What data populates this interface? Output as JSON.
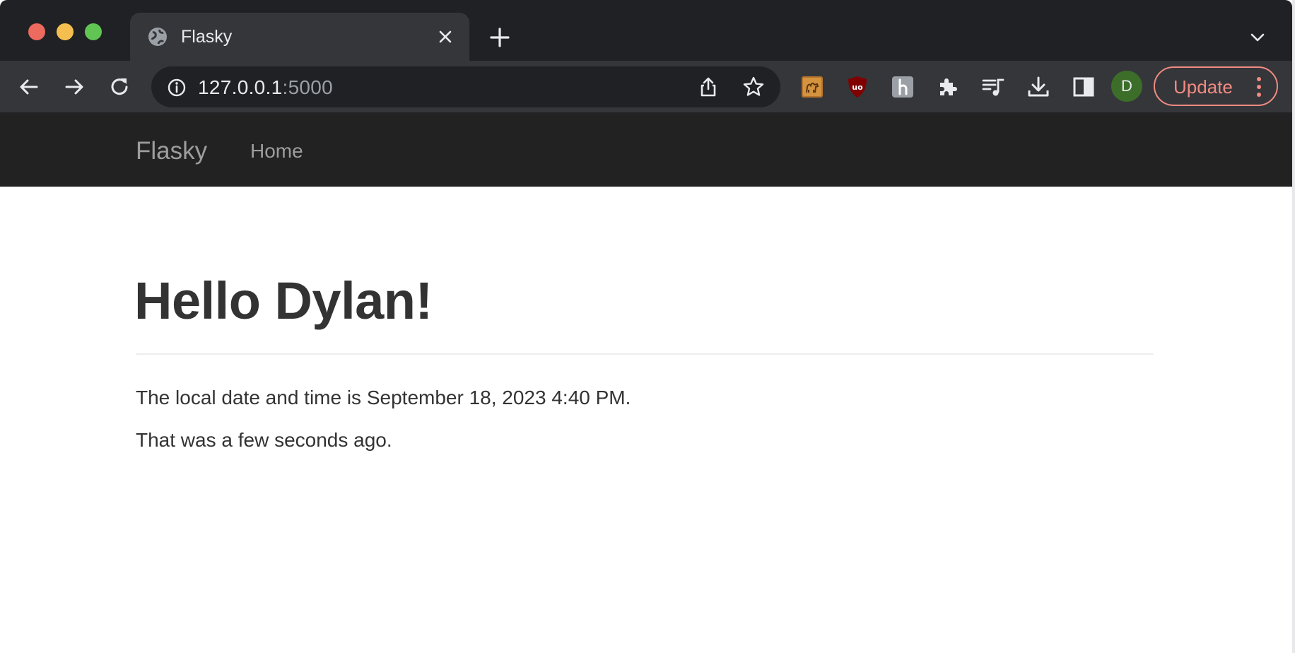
{
  "browser": {
    "tab": {
      "title": "Flasky"
    },
    "omnibox": {
      "host": "127.0.0.1",
      "port": ":5000"
    },
    "profile_initial": "D",
    "update_label": "Update"
  },
  "page": {
    "navbar": {
      "brand": "Flasky",
      "home": "Home"
    },
    "heading": "Hello Dylan!",
    "local_time_text": "The local date and time is September 18, 2023 4:40 PM.",
    "relative_time_text": "That was a few seconds ago."
  },
  "colors": {
    "navbar_bg": "#222222",
    "text": "#333333",
    "update_accent": "#f28b82",
    "avatar_bg": "#3c6e2a"
  }
}
